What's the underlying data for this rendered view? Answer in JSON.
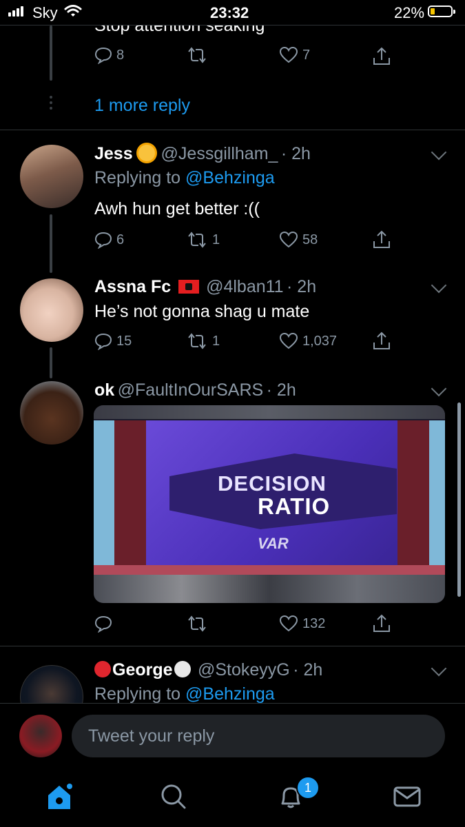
{
  "status_bar": {
    "carrier": "Sky",
    "time": "23:32",
    "battery": "22%"
  },
  "prev_tweet": {
    "text": "Stop attention seaking",
    "replies": "8",
    "likes": "7",
    "more_replies": "1 more reply"
  },
  "tweets": [
    {
      "name": "Jess",
      "handle": "@Jessgillham_",
      "time": "· 2h",
      "replying_label": "Replying to",
      "replying_to": "@Behzinga",
      "text": "Awh hun get better :((",
      "replies": "6",
      "retweets": "1",
      "likes": "58"
    },
    {
      "name": "Assna Fc",
      "handle": "@4lban11",
      "time": "· 2h",
      "text": "He’s not gonna shag u mate",
      "replies": "15",
      "retweets": "1",
      "likes": "1,037"
    },
    {
      "name": "ok",
      "handle": "@FaultInOurSARS",
      "time": "· 2h",
      "image_line1": "DECISION",
      "image_line2": "RATIO",
      "image_logo": "VAR",
      "likes": "132"
    },
    {
      "name": "George",
      "handle": "@StokeyyG",
      "time": "· 2h",
      "replying_label": "Replying to",
      "replying_to": "@Behzinga"
    }
  ],
  "compose": {
    "placeholder": "Tweet your reply"
  },
  "tab_bar": {
    "notification_count": "1"
  },
  "colors": {
    "accent": "#1d9bf0",
    "background": "#000000",
    "muted": "#8b98a5"
  }
}
